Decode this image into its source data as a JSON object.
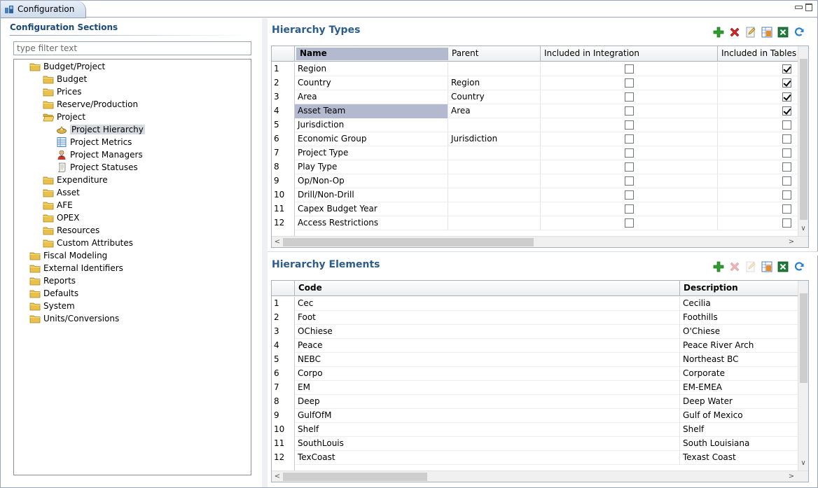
{
  "tab": {
    "title": "Configuration"
  },
  "left": {
    "section_title": "Configuration Sections",
    "filter_placeholder": "type filter text",
    "tree": [
      {
        "label": "Budget/Project",
        "icon": "folder-icon",
        "level": 0
      },
      {
        "label": "Budget",
        "icon": "folder-icon",
        "level": 1
      },
      {
        "label": "Prices",
        "icon": "folder-icon",
        "level": 1
      },
      {
        "label": "Reserve/Production",
        "icon": "folder-icon",
        "level": 1
      },
      {
        "label": "Project",
        "icon": "folder-open-icon",
        "level": 1
      },
      {
        "label": "Project Hierarchy",
        "icon": "hierarchy-icon",
        "level": 2,
        "selected": true
      },
      {
        "label": "Project Metrics",
        "icon": "metrics-table-icon",
        "level": 2
      },
      {
        "label": "Project Managers",
        "icon": "person-icon",
        "level": 2
      },
      {
        "label": "Project Statuses",
        "icon": "scroll-icon",
        "level": 2
      },
      {
        "label": "Expenditure",
        "icon": "folder-icon",
        "level": 1
      },
      {
        "label": "Asset",
        "icon": "folder-icon",
        "level": 1
      },
      {
        "label": "AFE",
        "icon": "folder-icon",
        "level": 1
      },
      {
        "label": "OPEX",
        "icon": "folder-icon",
        "level": 1
      },
      {
        "label": "Resources",
        "icon": "folder-icon",
        "level": 1
      },
      {
        "label": "Custom Attributes",
        "icon": "folder-icon",
        "level": 1
      },
      {
        "label": "Fiscal Modeling",
        "icon": "folder-icon",
        "level": 0
      },
      {
        "label": "External Identifiers",
        "icon": "folder-icon",
        "level": 0
      },
      {
        "label": "Reports",
        "icon": "folder-icon",
        "level": 0
      },
      {
        "label": "Defaults",
        "icon": "folder-icon",
        "level": 0
      },
      {
        "label": "System",
        "icon": "folder-icon",
        "level": 0
      },
      {
        "label": "Units/Conversions",
        "icon": "folder-icon",
        "level": 0
      }
    ]
  },
  "hierarchy_types": {
    "title": "Hierarchy Types",
    "toolbar": [
      "add-icon",
      "delete-icon",
      "edit-icon",
      "export-icon",
      "excel-icon",
      "refresh-icon"
    ],
    "columns": [
      "Name",
      "Parent",
      "Included in Integration",
      "Included in Tables"
    ],
    "selected_row": 4,
    "rows": [
      {
        "n": "1",
        "name": "Region",
        "parent": "",
        "integration": false,
        "tables": true
      },
      {
        "n": "2",
        "name": "Country",
        "parent": "Region",
        "integration": false,
        "tables": true
      },
      {
        "n": "3",
        "name": "Area",
        "parent": "Country",
        "integration": false,
        "tables": true
      },
      {
        "n": "4",
        "name": "Asset Team",
        "parent": "Area",
        "integration": false,
        "tables": true
      },
      {
        "n": "5",
        "name": "Jurisdiction",
        "parent": "",
        "integration": false,
        "tables": false
      },
      {
        "n": "6",
        "name": "Economic Group",
        "parent": "Jurisdiction",
        "integration": false,
        "tables": false
      },
      {
        "n": "7",
        "name": "Project Type",
        "parent": "",
        "integration": false,
        "tables": false
      },
      {
        "n": "8",
        "name": "Play Type",
        "parent": "",
        "integration": false,
        "tables": false
      },
      {
        "n": "9",
        "name": "Op/Non-Op",
        "parent": "",
        "integration": false,
        "tables": false
      },
      {
        "n": "10",
        "name": "Drill/Non-Drill",
        "parent": "",
        "integration": false,
        "tables": false
      },
      {
        "n": "11",
        "name": "Capex Budget Year",
        "parent": "",
        "integration": false,
        "tables": false
      },
      {
        "n": "12",
        "name": "Access Restrictions",
        "parent": "",
        "integration": false,
        "tables": false
      }
    ]
  },
  "hierarchy_elements": {
    "title": "Hierarchy Elements",
    "toolbar": [
      "add-icon",
      "delete-icon",
      "edit-icon",
      "export-icon",
      "excel-icon",
      "refresh-icon"
    ],
    "columns": [
      "Code",
      "Description"
    ],
    "rows": [
      {
        "n": "1",
        "code": "Cec",
        "desc": "Cecilia"
      },
      {
        "n": "2",
        "code": "Foot",
        "desc": "Foothills"
      },
      {
        "n": "3",
        "code": "OChiese",
        "desc": "O'Chiese"
      },
      {
        "n": "4",
        "code": "Peace",
        "desc": "Peace River Arch"
      },
      {
        "n": "5",
        "code": "NEBC",
        "desc": "Northeast BC"
      },
      {
        "n": "6",
        "code": "Corpo",
        "desc": "Corporate"
      },
      {
        "n": "7",
        "code": "EM",
        "desc": "EM-EMEA"
      },
      {
        "n": "8",
        "code": "Deep",
        "desc": "Deep Water"
      },
      {
        "n": "9",
        "code": "GulfOfM",
        "desc": "Gulf of Mexico"
      },
      {
        "n": "10",
        "code": "Shelf",
        "desc": "Shelf"
      },
      {
        "n": "11",
        "code": "SouthLouis",
        "desc": "South Louisiana"
      },
      {
        "n": "12",
        "code": "TexCoast",
        "desc": "Texast Coast"
      }
    ]
  },
  "colors": {
    "title_blue": "#2b5c8c",
    "selection": "#b3bacf",
    "folder": "#e8c04a"
  }
}
